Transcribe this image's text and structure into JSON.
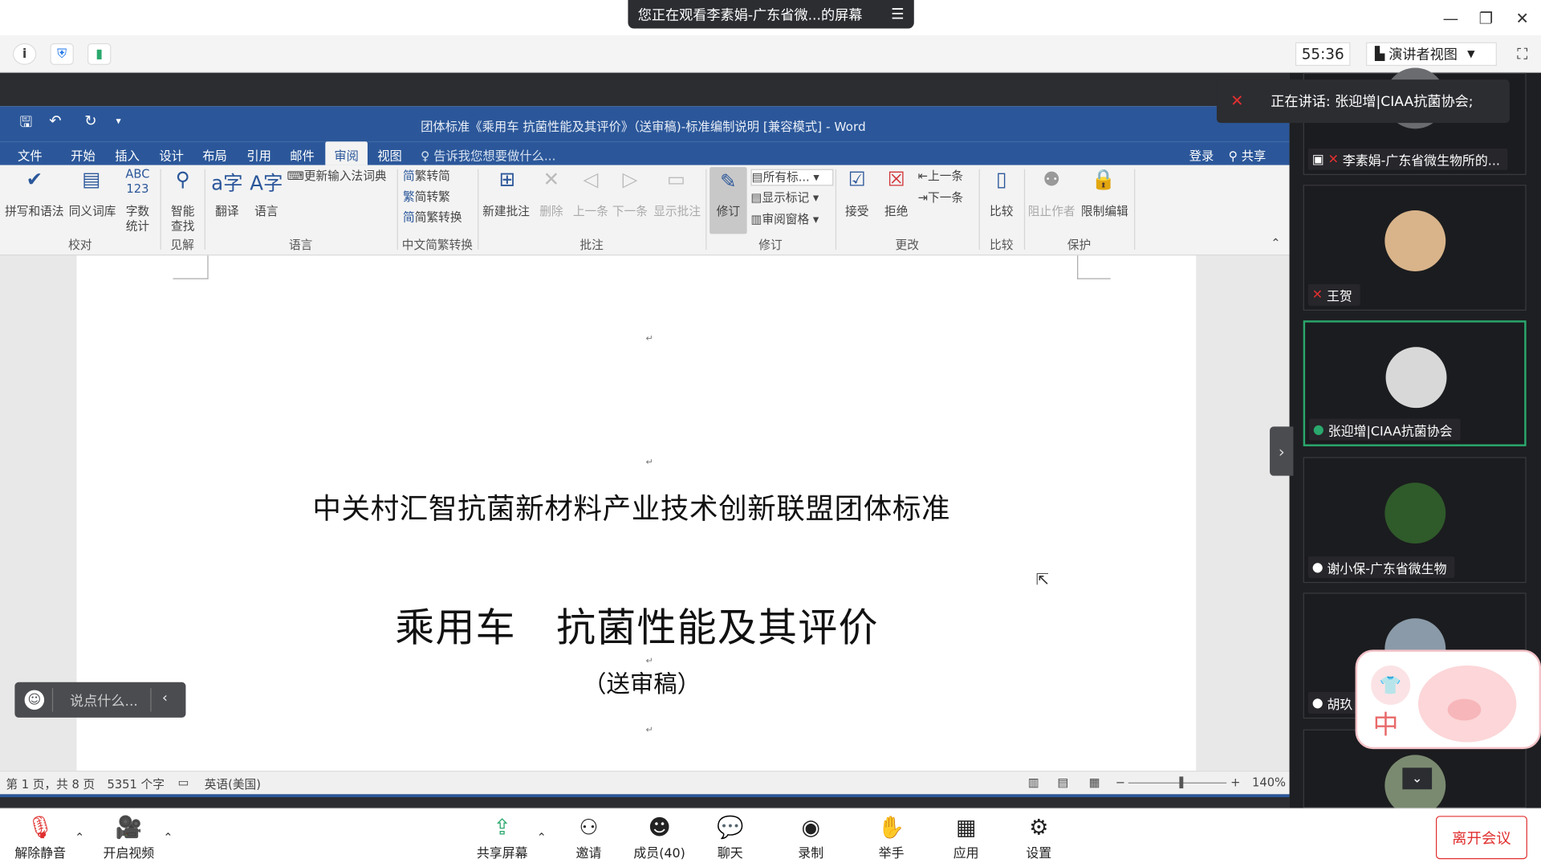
{
  "screen_share": {
    "banner": "您正在观看李素娟-广东省微...的屏幕"
  },
  "meeting": {
    "timer": "55:36",
    "view_label": "演讲者视图"
  },
  "word": {
    "window_title": "团体标准《乘用车 抗菌性能及其评价》（送审稿)-标准编制说明 [兼容模式] - Word",
    "tabs": [
      "文件",
      "开始",
      "插入",
      "设计",
      "布局",
      "引用",
      "邮件",
      "审阅",
      "视图"
    ],
    "active_tab": "审阅",
    "tell_me": "告诉我您想要做什么...",
    "login": "登录",
    "share": "共享",
    "ribbon": {
      "spelling": "拼写和语法",
      "thesaurus": "同义词库",
      "wordcount_top": "字数",
      "wordcount_bottom": "统计",
      "smart_top": "智能",
      "smart_bottom": "查找",
      "translate": "翻译",
      "language": "语言",
      "update_ime": "更新输入法词典",
      "trad_to_simp": "繁转简",
      "simp_to_trad": "简转繁",
      "convert": "简繁转换",
      "new_comment": "新建批注",
      "delete": "删除",
      "prev": "上一条",
      "next": "下一条",
      "show_comments": "显示批注",
      "track": "修订",
      "all_markup": "所有标...",
      "show_markup": "显示标记",
      "review_pane": "审阅窗格",
      "accept": "接受",
      "reject": "拒绝",
      "prev_change": "上一条",
      "next_change": "下一条",
      "compare": "比较",
      "block_authors": "阻止作者",
      "restrict": "限制编辑",
      "groups": [
        "校对",
        "见解",
        "语言",
        "中文简繁转换",
        "批注",
        "修订",
        "更改",
        "比较",
        "保护"
      ]
    },
    "document": {
      "org": "中关村汇智抗菌新材料产业技术创新联盟团体标准",
      "title": "乘用车　抗菌性能及其评价",
      "subtitle": "（送审稿）"
    },
    "status": {
      "page": "第 1 页，共 8 页",
      "words": "5351 个字",
      "lang": "英语(美国)",
      "zoom": "140%"
    }
  },
  "chat_input": {
    "placeholder": "说点什么..."
  },
  "speaking": {
    "label": "正在讲话: 张迎增|CIAA抗菌协会;"
  },
  "participants": [
    {
      "name": "李素娟-广东省微生物所的..."
    },
    {
      "name": "王贺"
    },
    {
      "name": "张迎增|CIAA抗菌协会"
    },
    {
      "name": "谢小保-广东省微生物"
    },
    {
      "name": "胡玖"
    }
  ],
  "sticker": {
    "char": "中"
  },
  "bottom_bar": {
    "unmute": "解除静音",
    "video": "开启视频",
    "share": "共享屏幕",
    "invite": "邀请",
    "members": "成员(40)",
    "chat": "聊天",
    "record": "录制",
    "raise": "举手",
    "apps": "应用",
    "settings": "设置",
    "leave": "离开会议"
  },
  "colors": {
    "word_blue": "#2b579a",
    "accent_green": "#2aa86d",
    "leave_red": "#e0302f"
  }
}
